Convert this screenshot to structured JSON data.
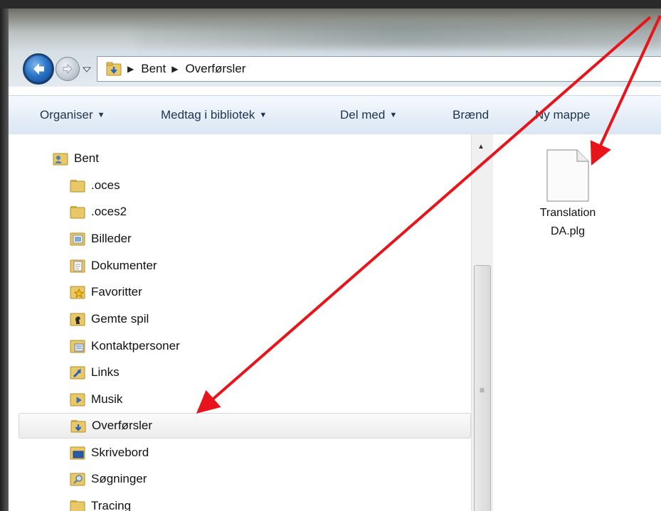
{
  "address": {
    "crumbs": [
      "Bent",
      "Overførsler"
    ]
  },
  "commandbar": {
    "organize": "Organiser",
    "include_library": "Medtag i bibliotek",
    "share_with": "Del med",
    "burn": "Brænd",
    "new_folder": "Ny mappe"
  },
  "tree": {
    "root": "Bent",
    "items": [
      ".oces",
      ".oces2",
      "Billeder",
      "Dokumenter",
      "Favoritter",
      "Gemte spil",
      "Kontaktpersoner",
      "Links",
      "Musik",
      "Overførsler",
      "Skrivebord",
      "Søgninger",
      "Tracing"
    ],
    "selected": "Overførsler"
  },
  "files": [
    {
      "line1": "Translation",
      "line2": "DA.plg",
      "icon": "blank-file-icon"
    }
  ],
  "colors": {
    "annotation_arrow": "#e8141b",
    "accent": "#2b74c7"
  }
}
